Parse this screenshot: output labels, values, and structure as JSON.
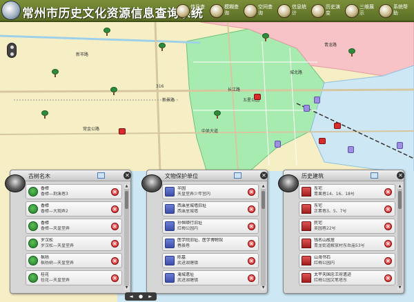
{
  "app": {
    "title": "常州市历史文化资源信息查询系统"
  },
  "top_nav": [
    {
      "label": "信息查询",
      "icon": "info-query-icon"
    },
    {
      "label": "模糊查询",
      "icon": "fuzzy-query-icon"
    },
    {
      "label": "空间查询",
      "icon": "spatial-query-icon"
    },
    {
      "label": "信息统计",
      "icon": "statistics-icon"
    },
    {
      "label": "历史演变",
      "icon": "history-icon"
    },
    {
      "label": "三维展示",
      "icon": "3d-view-icon"
    },
    {
      "label": "系统帮助",
      "icon": "help-icon"
    }
  ],
  "map": {
    "labels": [
      "常金公路",
      "316",
      "新景路",
      "五星公园",
      "中吴大道",
      "长江路",
      "青龙路",
      "城北路",
      "新市路"
    ],
    "colors": {
      "yellow": "#f6efc6",
      "green": "#a8ebb0",
      "pink": "#f7c3c6",
      "blue": "#cde7f4",
      "highway": "#d6c7a0"
    }
  },
  "panels": [
    {
      "title": "古树名木",
      "icon": "tree-icon",
      "items": [
        {
          "name": "香樟",
          "addr": "香樟—荆溪巷3"
        },
        {
          "name": "香樟",
          "addr": "香樟—大观弄2"
        },
        {
          "name": "香樟",
          "addr": "香樟—天皇堂弄"
        },
        {
          "name": "罗汉松",
          "addr": "罗汉松—天皇堂弄"
        },
        {
          "name": "枫杨",
          "addr": "枫杨树—天皇堂弄"
        },
        {
          "name": "桂花",
          "addr": "桂花—天皇堂弄"
        }
      ]
    },
    {
      "title": "文物保护单位",
      "icon": "cube-icon",
      "items": [
        {
          "name": "半园",
          "addr": "天皇堂弄少年宫内"
        },
        {
          "name": "西瀛里城墙旧址",
          "addr": "西瀛里城墙"
        },
        {
          "name": "孙恒顺行旧址",
          "addr": "红梅公园内"
        },
        {
          "name": "医学院旧址、医学博物馆",
          "addr": "春晨巷"
        },
        {
          "name": "陈墓",
          "addr": "武进湖塘镇"
        },
        {
          "name": "淹城遗址",
          "addr": "武进湖塘镇"
        }
      ]
    },
    {
      "title": "历史建筑",
      "icon": "house-icon",
      "items": [
        {
          "name": "东宅",
          "addr": "青果巷14、16、18号"
        },
        {
          "name": "东宅",
          "addr": "正素巷3、5、7号"
        },
        {
          "name": "民宅",
          "addr": "吴园巷22号"
        },
        {
          "name": "钱名山故居",
          "addr": "青龙街道解放村东岳庙53号"
        },
        {
          "name": "山海书石",
          "addr": "红梅公园内"
        },
        {
          "name": "太平天国忠王府遗迹",
          "addr": "红梅公园文笔塔东"
        }
      ]
    }
  ],
  "pager": {
    "prev": "◄",
    "dot": "●",
    "next": "►"
  }
}
